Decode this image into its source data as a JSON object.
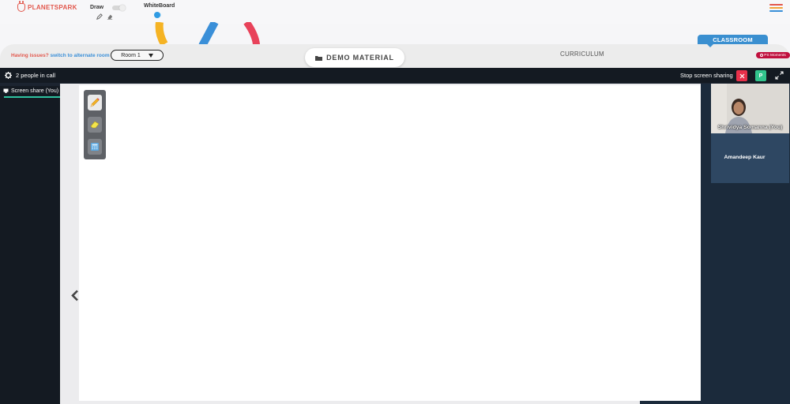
{
  "brand": {
    "name": "PLANETSPARK"
  },
  "toolbar": {
    "draw_label": "Draw",
    "whiteboard_label": "WhiteBoard"
  },
  "subbar": {
    "issues_text": "Having issues?",
    "alt_room_link": "switch to alternate room",
    "room_selected": "Room 1",
    "demo_material_label": "DEMO MATERIAL",
    "curriculum_label": "CURRICULUM",
    "classroom_label": "CLASSROOM",
    "ps_moments_label": "PS Moments"
  },
  "call": {
    "people_count_text": "2 people in call",
    "stop_sharing_label": "Stop screen sharing",
    "presenter_initial": "P",
    "share_tab_label": "Screen share (You)"
  },
  "participants": [
    {
      "name": "Shrividya Somanna (You)"
    },
    {
      "name": "Amandeep Kaur"
    }
  ],
  "colors": {
    "brand_red": "#e2574c",
    "accent_blue": "#3a8fd0",
    "call_bg": "#141a22",
    "stop_red": "#e8304a",
    "presenter_green": "#32c48d",
    "ps_moments": "#c0103e"
  },
  "icons": {
    "draw_tools": [
      "pencil-icon",
      "eraser-icon"
    ],
    "palette_tools": [
      "pencil-icon",
      "eraser-icon",
      "calculator-icon"
    ]
  }
}
